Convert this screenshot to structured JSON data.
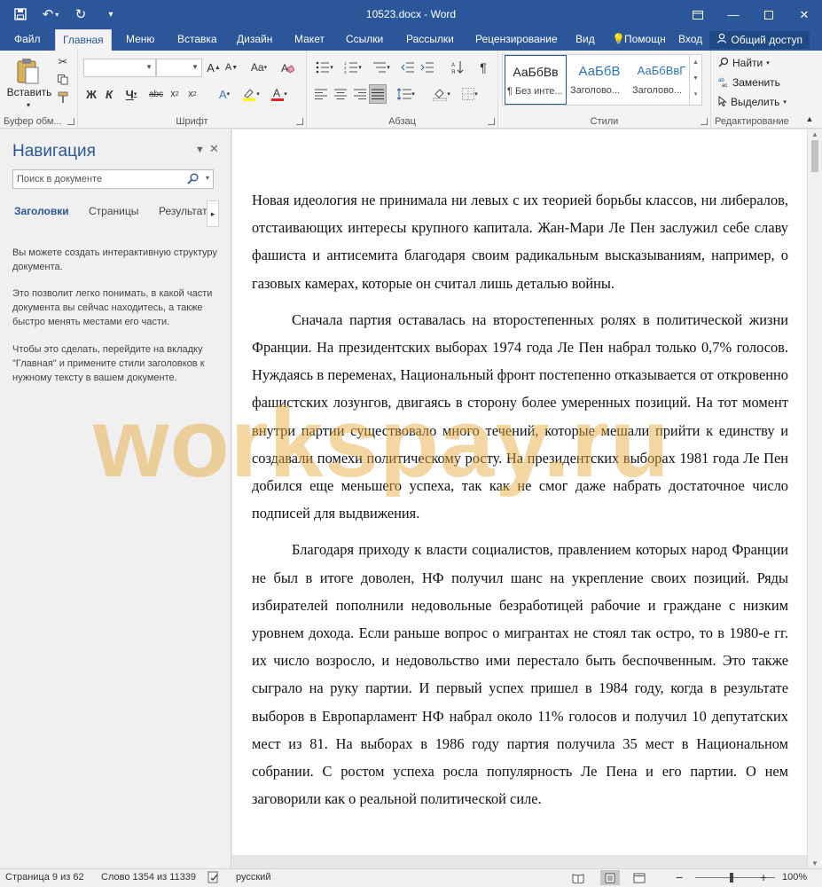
{
  "window": {
    "title": "10523.docx - Word"
  },
  "ribbon_tabs": [
    {
      "label": "Файл"
    },
    {
      "label": "Главная"
    },
    {
      "label": "Меню"
    },
    {
      "label": "Вставка"
    },
    {
      "label": "Дизайн"
    },
    {
      "label": "Макет"
    },
    {
      "label": "Ссылки"
    },
    {
      "label": "Рассылки"
    },
    {
      "label": "Рецензирование"
    },
    {
      "label": "Вид"
    },
    {
      "label": "Помощн"
    },
    {
      "label": "Вход"
    }
  ],
  "share_label": "Общий доступ",
  "ribbon": {
    "clipboard": {
      "paste_label": "Вставить",
      "group_label": "Буфер обм..."
    },
    "font": {
      "group_label": "Шрифт",
      "font_name": "",
      "font_size": ""
    },
    "paragraph": {
      "group_label": "Абзац"
    },
    "styles": {
      "group_label": "Стили",
      "items": [
        {
          "sample": "АаБбВв",
          "name": "¶ Без инте..."
        },
        {
          "sample": "АаБбВ",
          "name": "Заголово..."
        },
        {
          "sample": "АаБбВвГ",
          "name": "Заголово..."
        }
      ]
    },
    "editing": {
      "group_label": "Редактирование",
      "find": "Найти",
      "replace": "Заменить",
      "select": "Выделить"
    }
  },
  "nav": {
    "title": "Навигация",
    "search_placeholder": "Поиск в документе",
    "tabs": [
      {
        "label": "Заголовки"
      },
      {
        "label": "Страницы"
      },
      {
        "label": "Результаты"
      }
    ],
    "help": [
      "Вы можете создать интерактивную структуру документа.",
      "Это позволит легко понимать, в какой части документа вы сейчас находитесь, а также быстро менять местами его части.",
      "Чтобы это сделать, перейдите на вкладку \"Главная\" и примените стили заголовков к нужному тексту в вашем документе."
    ]
  },
  "document": {
    "paragraphs": [
      "Новая идеология не принимала ни левых с их теорией борьбы классов, ни либералов, отстаивающих интересы крупного капитала. Жан-Мари Ле Пен заслужил себе славу фашиста и антисемита благодаря своим радикальным высказываниям, например, о газовых камерах, которые он считал лишь деталью войны.",
      "Сначала партия оставалась на второстепенных ролях в политической жизни Франции. На президентских выборах 1974 года Ле Пен набрал только 0,7% голосов. Нуждаясь в переменах, Национальный фронт постепенно отказывается от откровенно фашистских лозунгов, двигаясь в сторону более умеренных позиций. На тот момент внутри партии существовало много течений, которые мешали прийти к единству и создавали помехи политическому росту. На президентских выборах 1981 года Ле Пен добился еще меньшего успеха, так как не смог даже набрать достаточное число подписей для выдвижения.",
      "Благодаря приходу к власти социалистов, правлением которых народ Франции не был в итоге доволен, НФ получил шанс на укрепление своих позиций. Ряды избирателей пополнили недовольные безработицей рабочие и граждане с низким уровнем дохода. Если раньше вопрос о мигрантах не стоял так остро, то в 1980-е гг. их число возросло, и недовольство ими перестало быть беспочвенным. Это также сыграло на руку партии. И первый успех пришел в 1984 году, когда в результате выборов в Европарламент НФ набрал около 11% голосов и получил 10 депутатских мест из 81. На выборах в 1986 году партия получила 35 мест в Национальном собрании. С ростом успеха росла популярность Ле Пена и его партии. О нем заговорили как о реальной политической силе."
    ]
  },
  "watermark": "workspay.ru",
  "status": {
    "page": "Страница 9 из 62",
    "words": "Слово 1354 из 11339",
    "language": "русский",
    "zoom": "100%"
  }
}
